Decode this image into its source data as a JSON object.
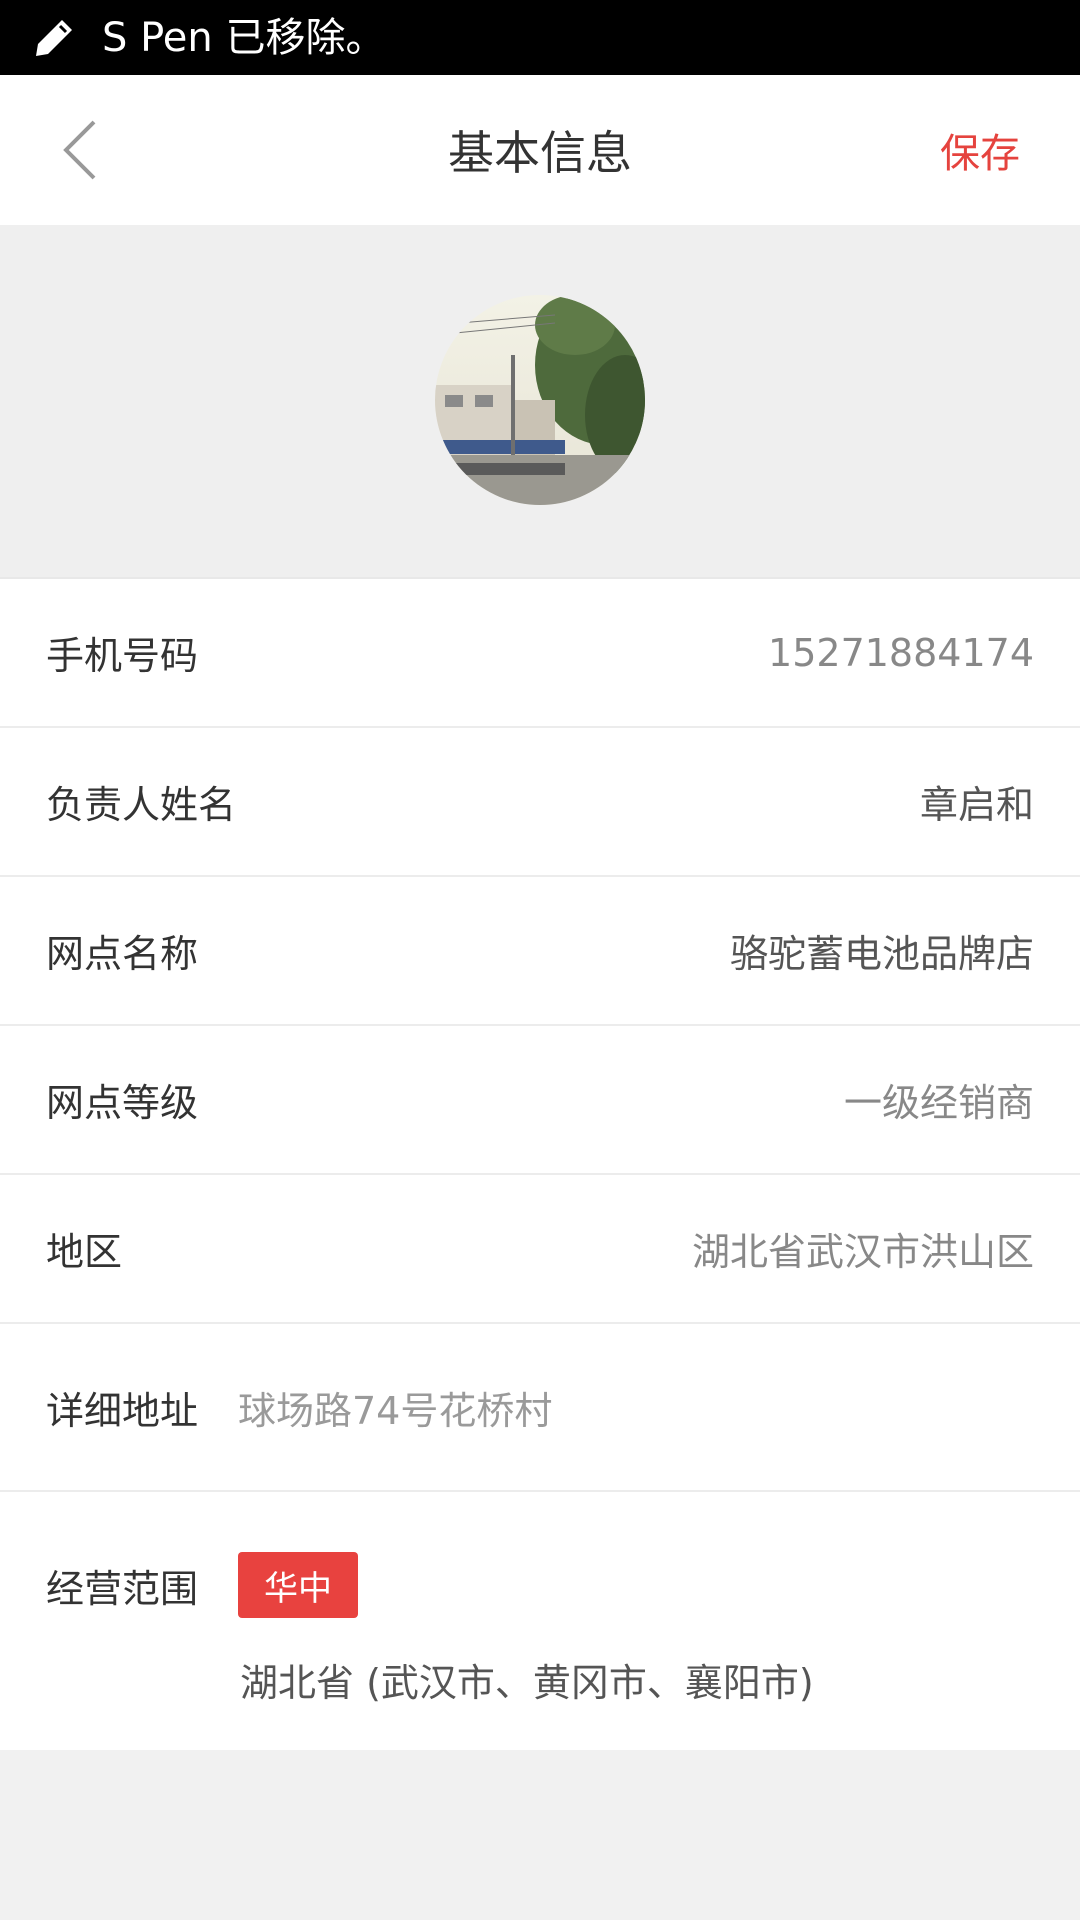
{
  "status_bar": {
    "text": "S Pen 已移除。",
    "icon": "pen-icon"
  },
  "nav": {
    "title": "基本信息",
    "save_label": "保存",
    "back_icon": "chevron-left-icon"
  },
  "avatar": {
    "icon": "avatar-photo"
  },
  "fields": {
    "phone": {
      "label": "手机号码",
      "value": "15271884174"
    },
    "owner": {
      "label": "负责人姓名",
      "value": "章启和"
    },
    "outlet_name": {
      "label": "网点名称",
      "value": "骆驼蓄电池品牌店"
    },
    "outlet_level": {
      "label": "网点等级",
      "value": "一级经销商"
    },
    "region": {
      "label": "地区",
      "value": "湖北省武汉市洪山区"
    },
    "address": {
      "label": "详细地址",
      "value": "球场路74号花桥村"
    },
    "scope": {
      "label": "经营范围",
      "badge": "华中",
      "detail": "湖北省 (武汉市、黄冈市、襄阳市)"
    }
  },
  "colors": {
    "accent": "#e5433e",
    "badge_bg": "#e8423f",
    "status_bar": "#000000",
    "background": "#f1f1f1"
  }
}
